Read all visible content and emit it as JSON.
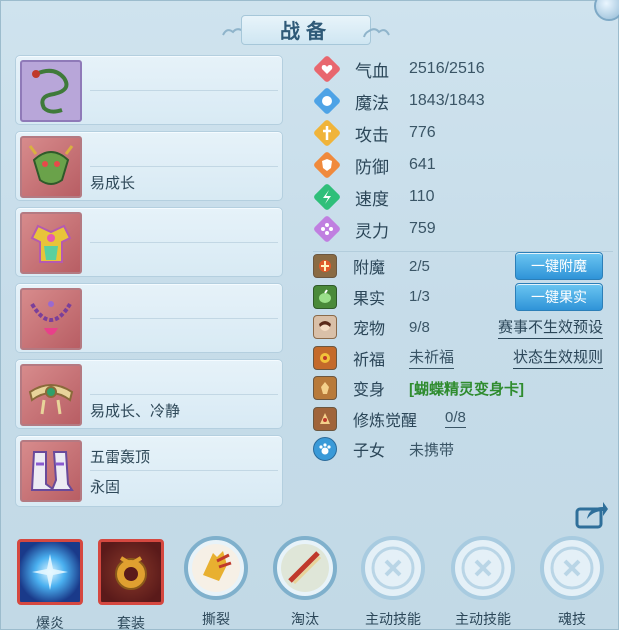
{
  "title": "战备",
  "equipment": [
    {
      "icon": "whip-icon",
      "line1": "",
      "line2": ""
    },
    {
      "icon": "dragon-mask-icon",
      "line1": "",
      "line2": "易成长"
    },
    {
      "icon": "armor-icon",
      "line1": "",
      "line2": ""
    },
    {
      "icon": "necklace-icon",
      "line1": "",
      "line2": ""
    },
    {
      "icon": "belt-icon",
      "line1": "",
      "line2": "易成长、冷静"
    },
    {
      "icon": "boots-icon",
      "line1": "五雷轰顶",
      "line2": "永固"
    }
  ],
  "stats": [
    {
      "label": "气血",
      "value": "2516/2516",
      "icon": "heart-icon",
      "color": "#e8676e"
    },
    {
      "label": "魔法",
      "value": "1843/1843",
      "icon": "magic-icon",
      "color": "#4ea3e6"
    },
    {
      "label": "攻击",
      "value": "776",
      "icon": "attack-icon",
      "color": "#f0b43a"
    },
    {
      "label": "防御",
      "value": "641",
      "icon": "defense-icon",
      "color": "#f08a3c"
    },
    {
      "label": "速度",
      "value": "110",
      "icon": "speed-icon",
      "color": "#2fbf7a"
    },
    {
      "label": "灵力",
      "value": "759",
      "icon": "spirit-icon",
      "color": "#c07fe0"
    }
  ],
  "extras": {
    "enchant": {
      "label": "附魔",
      "value": "2/5",
      "button": "一键附魔"
    },
    "fruit": {
      "label": "果实",
      "value": "1/3",
      "button": "一键果实"
    },
    "pet": {
      "label": "宠物",
      "value": "9/8",
      "link": "赛事不生效预设"
    },
    "blessing": {
      "label": "祈福",
      "value": "未祈福",
      "link": "状态生效规则"
    },
    "transform": {
      "label": "变身",
      "value": "[蝴蝶精灵变身卡]"
    },
    "cultivation": {
      "label": "修炼觉醒",
      "value": "0/8"
    },
    "child": {
      "label": "子女",
      "value": "未携带"
    }
  },
  "skills": [
    {
      "label": "爆炎",
      "icon": "blast-fire-icon",
      "type": "square"
    },
    {
      "label": "套装",
      "icon": "set-icon",
      "type": "square"
    },
    {
      "label": "撕裂",
      "icon": "tear-icon",
      "type": "ring"
    },
    {
      "label": "淘汰",
      "icon": "eliminate-icon",
      "type": "ring"
    },
    {
      "label": "主动技能",
      "icon": "active-skill-icon",
      "type": "empty"
    },
    {
      "label": "主动技能",
      "icon": "active-skill-icon",
      "type": "empty"
    },
    {
      "label": "魂技",
      "icon": "soul-skill-icon",
      "type": "empty"
    }
  ]
}
